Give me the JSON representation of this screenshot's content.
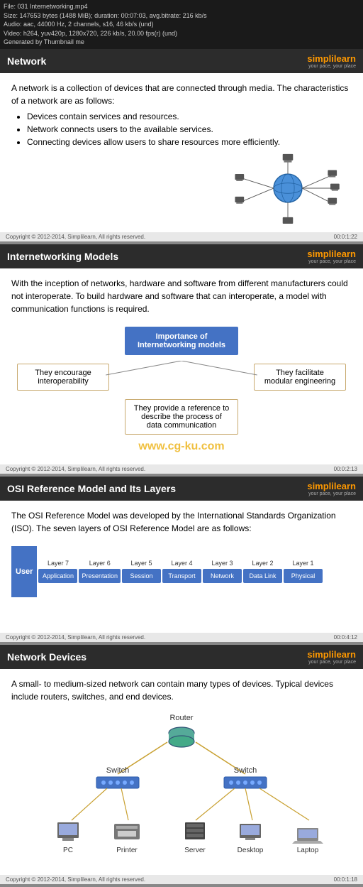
{
  "fileInfo": {
    "line1": "File: 031 Internetworking.mp4",
    "line2": "Size: 147653 bytes (1488 MiB); duration: 00:07:03, avg.bitrate: 216 kb/s",
    "line3": "Audio: aac, 44000 Hz, 2 channels, s16, 46 kb/s (und)",
    "line4": "Video: h264, yuv420p, 1280x720, 226 kb/s, 20.00 fps(r) (und)",
    "line5": "Generated by Thumbnail me"
  },
  "sections": {
    "network": {
      "title": "Network",
      "brand": "simpli",
      "brandHighlight": "learn",
      "tagline": "your pace, your place",
      "content": {
        "intro": "A network is a collection of devices that are connected through media. The characteristics of a network are as follows:",
        "bullets": [
          "Devices contain services and resources.",
          "Network connects users to the available services.",
          "Connecting devices allow users to share resources more efficiently."
        ]
      },
      "footer": {
        "copyright": "Copyright © 2012-2014, Simplilearn, All rights reserved.",
        "timestamp": "00:0:1:22"
      }
    },
    "internetworking": {
      "title": "Internetworking Models",
      "brand": "simpli",
      "brandHighlight": "learn",
      "tagline": "your pace, your place",
      "intro": "With the inception of networks, hardware and software from different manufacturers could not interoperate. To build hardware and software that can interoperate, a model with communication functions is required.",
      "diagram": {
        "center": "Importance of Internetworking models",
        "left": "They encourage interoperability",
        "right": "They facilitate modular engineering",
        "bottom": "They provide a reference to describe the process of data communication"
      },
      "watermark": "www.cg-ku.com",
      "footer": {
        "copyright": "Copyright © 2012-2014, Simplilearn, All rights reserved.",
        "timestamp": "00:0:2:13"
      }
    },
    "osi": {
      "title": "OSI Reference Model and Its Layers",
      "brand": "simpli",
      "brandHighlight": "learn",
      "tagline": "your pace, your place",
      "intro": "The OSI Reference Model was developed by the International Standards Organization (ISO). The seven layers of OSI Reference Model are as follows:",
      "userLabel": "User",
      "layers": [
        {
          "num": "Layer 7",
          "name": "Application"
        },
        {
          "num": "Layer 6",
          "name": "Presentation"
        },
        {
          "num": "Layer 5",
          "name": "Session"
        },
        {
          "num": "Layer 4",
          "name": "Transport"
        },
        {
          "num": "Layer 3",
          "name": "Network"
        },
        {
          "num": "Layer 2",
          "name": "Data Link"
        },
        {
          "num": "Layer 1",
          "name": "Physical"
        }
      ],
      "footer": {
        "copyright": "Copyright © 2012-2014, Simplilearn, All rights reserved.",
        "timestamp": "00:0:4:12"
      }
    },
    "networkDevices": {
      "title": "Network Devices",
      "brand": "simpli",
      "brandHighlight": "learn",
      "tagline": "your pace, your place",
      "intro": "A small- to medium-sized network can contain many types of devices. Typical devices include routers, switches, and end devices.",
      "devices": {
        "router": "Router",
        "switch1": "Switch",
        "switch2": "Switch",
        "pc": "PC",
        "printer": "Printer",
        "server": "Server",
        "desktop": "Desktop",
        "laptop": "Laptop"
      },
      "footer": {
        "copyright": "Copyright © 2012-2014, Simplilearn, All rights reserved.",
        "timestamp": "00:0:1:18"
      }
    }
  }
}
